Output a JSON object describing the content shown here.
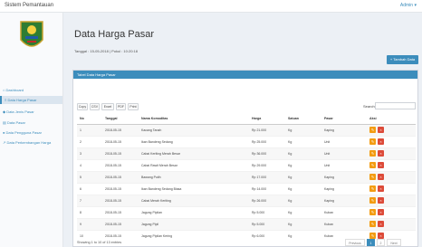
{
  "app": {
    "title": "Sistem Pemantauan",
    "user": "Admin"
  },
  "sidebar": {
    "items": [
      {
        "label": "Dashboard"
      },
      {
        "label": "Data Harga Pasar"
      },
      {
        "label": "Data Jenis Pasar"
      },
      {
        "label": "Data Pasar"
      },
      {
        "label": "Data Pengguna Pasar"
      },
      {
        "label": "Data Perkembangan Harga"
      }
    ]
  },
  "page": {
    "title": "Data Harga Pasar",
    "date": "Tanggal : 15-05-2018 | Pukul : 10:20:18",
    "add_label": "+ Tambah Data"
  },
  "panel": {
    "title": "Tabel Data Harga Pasar"
  },
  "export": {
    "copy": "Copy",
    "csv": "CSV",
    "excel": "Excel",
    "pdf": "PDF",
    "print": "Print"
  },
  "search": {
    "label": "Search:",
    "value": ""
  },
  "table": {
    "columns": [
      "No",
      "Tanggal",
      "Nama Komoditas",
      "Harga",
      "Satuan",
      "Pasar",
      "Aksi"
    ],
    "rows": [
      {
        "no": "1",
        "date": "2018-05-15",
        "name": "Kacang Tanah",
        "price": "Rp 21.000",
        "unit": "Kg",
        "market": "Kaping"
      },
      {
        "no": "2",
        "date": "2018-05-15",
        "name": "Ikan Bandeng Sedang",
        "price": "Rp 25.000",
        "unit": "Kg",
        "market": "Unit"
      },
      {
        "no": "3",
        "date": "2018-05-15",
        "name": "Cabai Keriting Merah Besar",
        "price": "Rp 36.000",
        "unit": "Kg",
        "market": "Unit"
      },
      {
        "no": "4",
        "date": "2018-05-15",
        "name": "Cabai Rawit Merah Besar",
        "price": "Rp 29.000",
        "unit": "Kg",
        "market": "Unit"
      },
      {
        "no": "5",
        "date": "2018-05-15",
        "name": "Bawang Putih",
        "price": "Rp 17.000",
        "unit": "Kg",
        "market": "Kaping"
      },
      {
        "no": "6",
        "date": "2018-05-15",
        "name": "Ikan Bandeng Sedang Biasa",
        "price": "Rp 14.000",
        "unit": "Kg",
        "market": "Kaping"
      },
      {
        "no": "7",
        "date": "2018-05-15",
        "name": "Cabai Merah Keriting",
        "price": "Rp 26.000",
        "unit": "Kg",
        "market": "Kaping"
      },
      {
        "no": "8",
        "date": "2018-05-15",
        "name": "Jagung Pipilan",
        "price": "Rp 5.000",
        "unit": "Kg",
        "market": "Kuban"
      },
      {
        "no": "9",
        "date": "2018-05-15",
        "name": "Jagung Pipil",
        "price": "Rp 5.000",
        "unit": "Kg",
        "market": "Kuban"
      },
      {
        "no": "10",
        "date": "2018-05-15",
        "name": "Jagung Pipilan Kering",
        "price": "Rp 6.000",
        "unit": "Kg",
        "market": "Kuban"
      }
    ]
  },
  "footer": {
    "info": "Showing 1 to 10 of 13 entries",
    "prev": "Previous",
    "page1": "1",
    "page2": "2",
    "next": "Next"
  }
}
